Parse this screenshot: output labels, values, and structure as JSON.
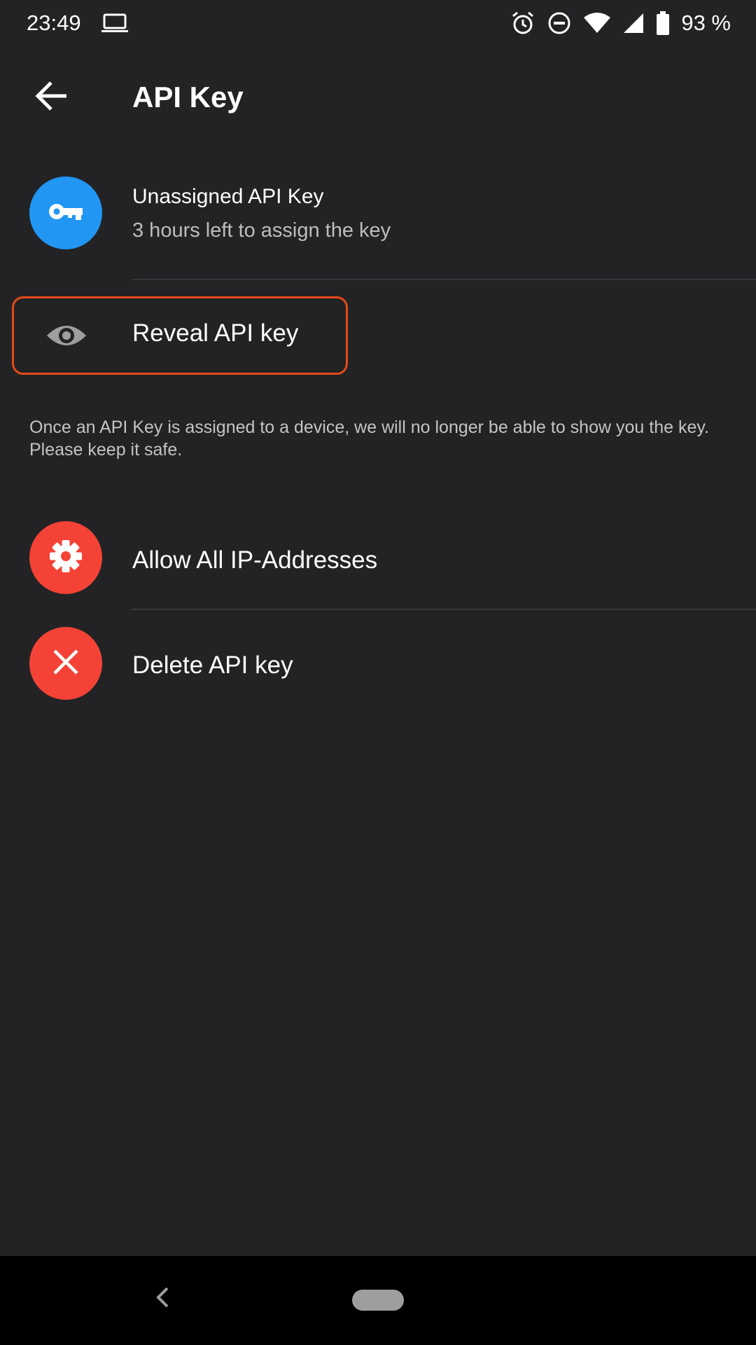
{
  "status_bar": {
    "time": "23:49",
    "battery_percent": "93 %",
    "icons": [
      "laptop-icon",
      "alarm-icon",
      "do-not-disturb-icon",
      "wifi-icon",
      "signal-icon",
      "battery-icon"
    ]
  },
  "app_bar": {
    "title": "API Key",
    "back_icon": "arrow-left-icon"
  },
  "key_info": {
    "title": "Unassigned API Key",
    "subtitle": "3 hours left to assign the key",
    "icon": "key-icon",
    "icon_color": "#2196f3"
  },
  "reveal": {
    "label": "Reveal API key",
    "icon": "eye-icon",
    "highlight_color": "#e64a19"
  },
  "note": "Once an API Key is assigned to a device, we will no longer be able to show you the key. Please keep it safe.",
  "actions": [
    {
      "label": "Allow All IP-Addresses",
      "icon": "gear-icon",
      "color": "#f44336"
    },
    {
      "label": "Delete API key",
      "icon": "close-icon",
      "color": "#f44336"
    }
  ],
  "nav_bar": {
    "back_icon": "nav-back-icon",
    "home_icon": "home-pill-icon"
  },
  "colors": {
    "background": "#232325",
    "divider": "#3a3a3d"
  }
}
